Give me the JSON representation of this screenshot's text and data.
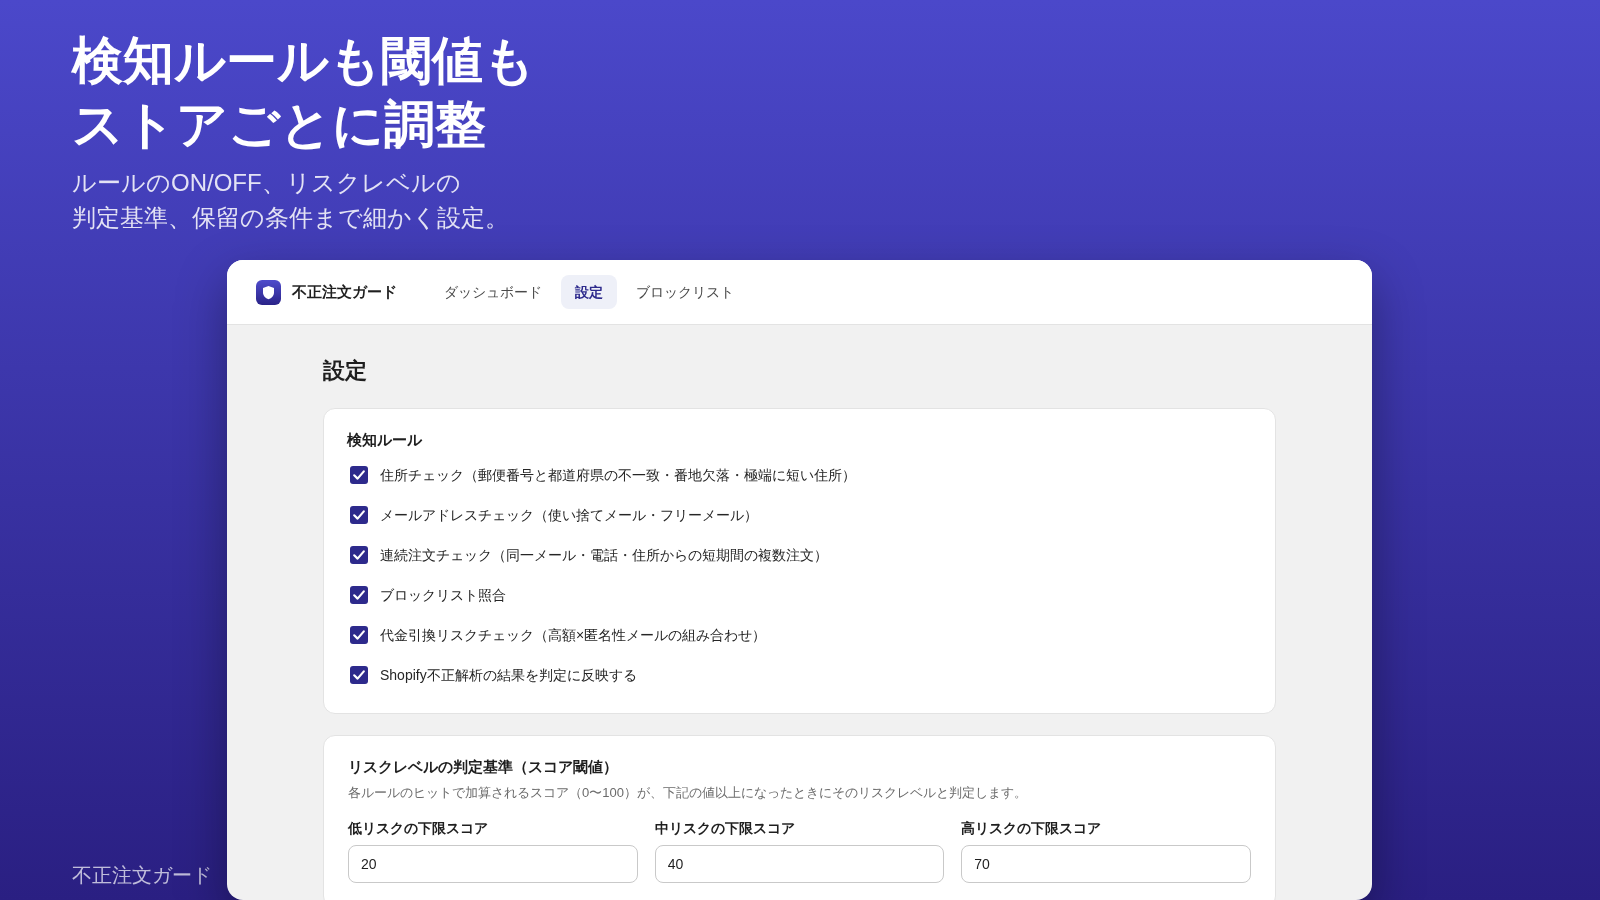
{
  "hero": {
    "title_lines": [
      "検知ルールも閾値も",
      "ストアごとに調整"
    ],
    "subtitle_lines": [
      "ルールのON/OFF、リスクレベルの",
      "判定基準、保留の条件まで細かく設定。"
    ]
  },
  "app": {
    "brand": "不正注文ガード",
    "tabs": [
      {
        "label": "ダッシュボード",
        "selected": false
      },
      {
        "label": "設定",
        "selected": true
      },
      {
        "label": "ブロックリスト",
        "selected": false
      }
    ]
  },
  "page_title": "設定",
  "rules_card": {
    "title": "検知ルール",
    "rules": [
      {
        "label": "住所チェック（郵便番号と都道府県の不一致・番地欠落・極端に短い住所）",
        "checked": true
      },
      {
        "label": "メールアドレスチェック（使い捨てメール・フリーメール）",
        "checked": true
      },
      {
        "label": "連続注文チェック（同一メール・電話・住所からの短期間の複数注文）",
        "checked": true
      },
      {
        "label": "ブロックリスト照合",
        "checked": true
      },
      {
        "label": "代金引換リスクチェック（高額×匿名性メールの組み合わせ）",
        "checked": true
      },
      {
        "label": "Shopify不正解析の結果を判定に反映する",
        "checked": true
      }
    ]
  },
  "threshold_card": {
    "title": "リスクレベルの判定基準（スコア閾値）",
    "description": "各ルールのヒットで加算されるスコア（0〜100）が、下記の値以上になったときにそのリスクレベルと判定します。",
    "fields": [
      {
        "label": "低リスクの下限スコア",
        "value": "20"
      },
      {
        "label": "中リスクの下限スコア",
        "value": "40"
      },
      {
        "label": "高リスクの下限スコア",
        "value": "70"
      }
    ]
  },
  "footer_brand": "不正注文ガード"
}
